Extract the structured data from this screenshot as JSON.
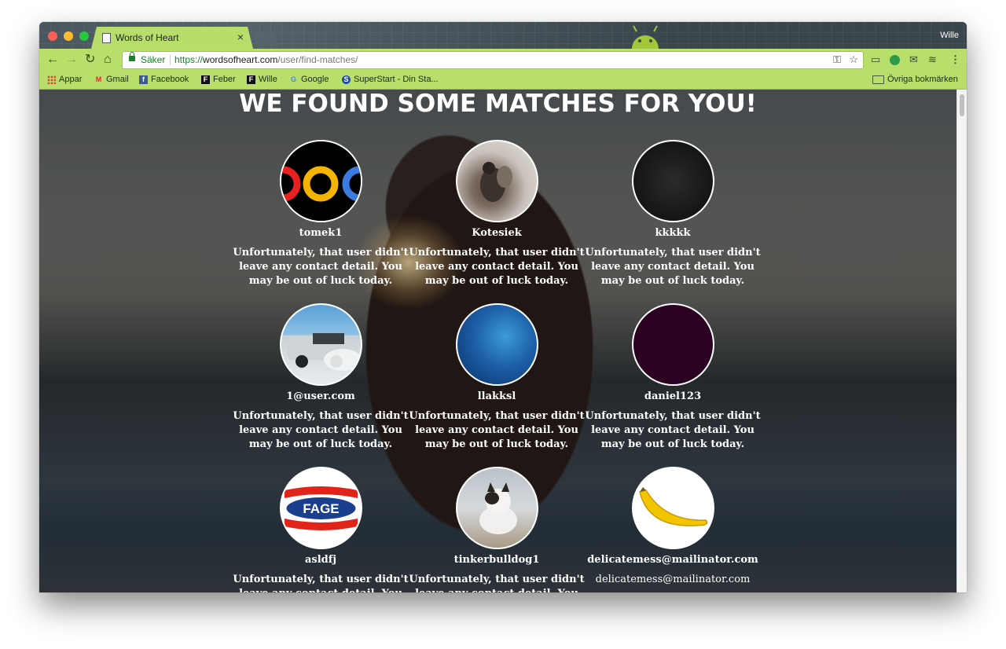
{
  "browser": {
    "tab_title": "Words of Heart",
    "tab_close": "×",
    "profile_name": "Wille",
    "secure_label": "Säker",
    "url_scheme": "https://",
    "url_host": "wordsofheart.com",
    "url_path": "/user/find-matches/"
  },
  "toolbar": {
    "back": "←",
    "forward": "→",
    "reload": "↻",
    "home": "⌂",
    "key": "⚿",
    "star": "☆",
    "menu": "⋮"
  },
  "bookmarks": {
    "items": [
      {
        "label": "Appar",
        "icon": "apps-grid-icon"
      },
      {
        "label": "Gmail",
        "icon": "gmail-icon",
        "glyph": "M"
      },
      {
        "label": "Facebook",
        "icon": "facebook-icon",
        "glyph": "f"
      },
      {
        "label": "Feber",
        "icon": "feber-icon",
        "glyph": "F"
      },
      {
        "label": "Wille",
        "icon": "wille-icon",
        "glyph": "F"
      },
      {
        "label": "Google",
        "icon": "google-icon",
        "glyph": "G"
      },
      {
        "label": "SuperStart - Din Sta...",
        "icon": "superstart-icon",
        "glyph": "S"
      }
    ],
    "other": "Övriga bokmärken"
  },
  "page": {
    "heading": "WE FOUND SOME MATCHES FOR YOU!",
    "matches": [
      {
        "username": "tomek1",
        "contact": "Unfortunately, that user didn't leave any contact detail. You may be out of luck today.",
        "avatar": "rings"
      },
      {
        "username": "Kotesiek",
        "contact": "Unfortunately, that user didn't leave any contact detail. You may be out of luck today.",
        "avatar": "cats"
      },
      {
        "username": "kkkkk",
        "contact": "Unfortunately, that user didn't leave any contact detail. You may be out of luck today.",
        "avatar": "dark"
      },
      {
        "username": "1@user.com",
        "contact": "Unfortunately, that user didn't leave any contact detail. You may be out of luck today.",
        "avatar": "truck"
      },
      {
        "username": "llakksl",
        "contact": "Unfortunately, that user didn't leave any contact detail. You may be out of luck today.",
        "avatar": "blue"
      },
      {
        "username": "daniel123",
        "contact": "Unfortunately, that user didn't leave any contact detail. You may be out of luck today.",
        "avatar": "purple"
      },
      {
        "username": "asldfj",
        "contact": "Unfortunately, that user didn't leave any contact detail. You may be out of luck today.",
        "avatar": "fage",
        "logo_text": "FAGE"
      },
      {
        "username": "tinkerbulldog1",
        "contact": "Unfortunately, that user didn't leave any contact detail. You may be out of luck today.",
        "avatar": "cat2"
      },
      {
        "username": "delicatemess@mailinator.com",
        "contact": "delicatemess@mailinator.com",
        "avatar": "banana"
      }
    ]
  },
  "colors": {
    "chrome_theme": "#b8de6c",
    "secure_green": "#18822b",
    "heading_text": "#ffffff"
  }
}
